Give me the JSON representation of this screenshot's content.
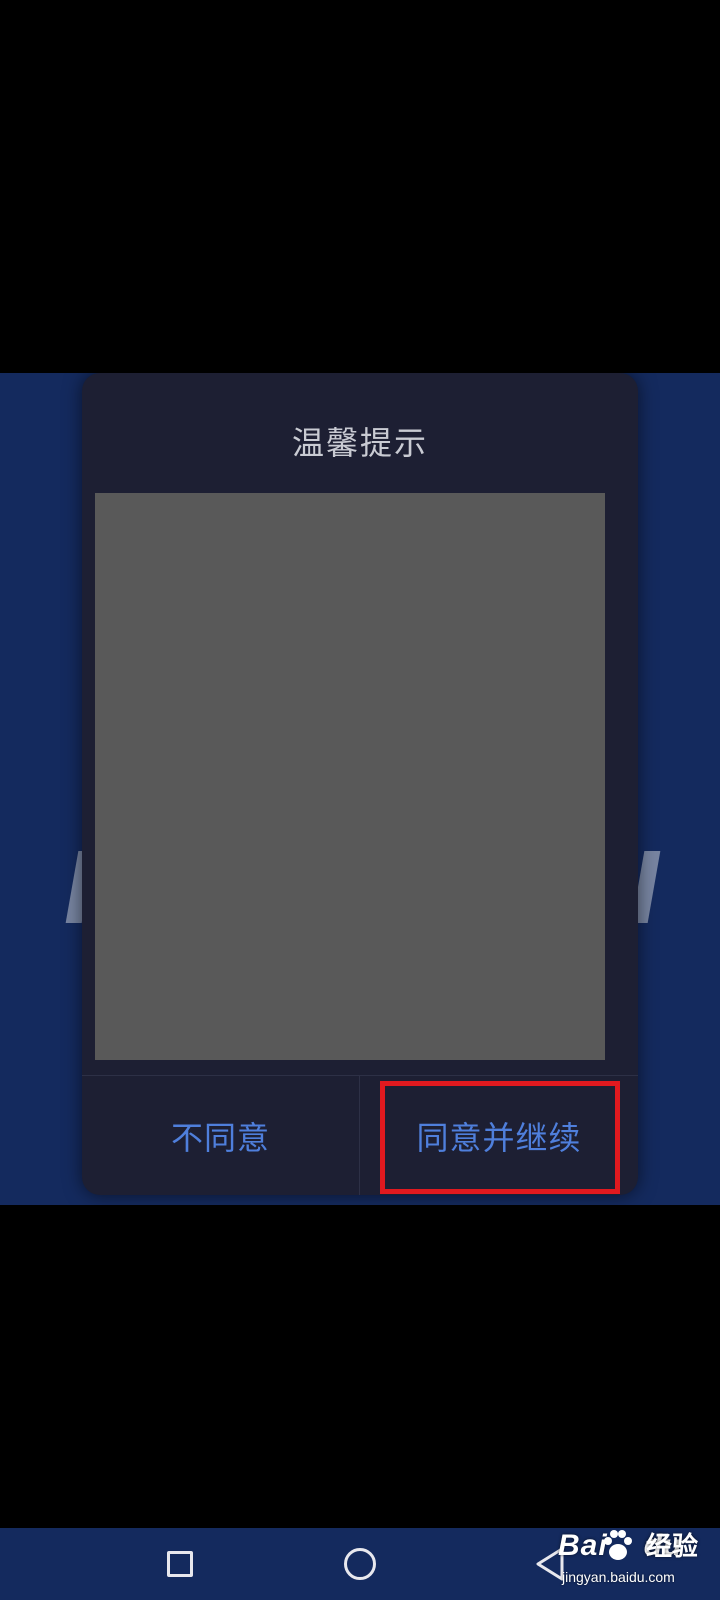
{
  "dialog": {
    "title": "温馨提示",
    "disagree_label": "不同意",
    "agree_label": "同意并继续"
  },
  "navbar": {
    "recent_icon": "square-icon",
    "home_icon": "circle-icon",
    "back_icon": "triangle-back-icon"
  },
  "watermark": {
    "brand": "Bai",
    "brand_suffix": "du",
    "sub": "经验",
    "url": "jingyan.baidu.com"
  },
  "colors": {
    "background": "#000000",
    "app_band": "#142a5e",
    "dialog_bg": "#1d1f33",
    "content_placeholder": "#595959",
    "button_text": "#4f7fdc",
    "highlight": "#e0191f"
  }
}
